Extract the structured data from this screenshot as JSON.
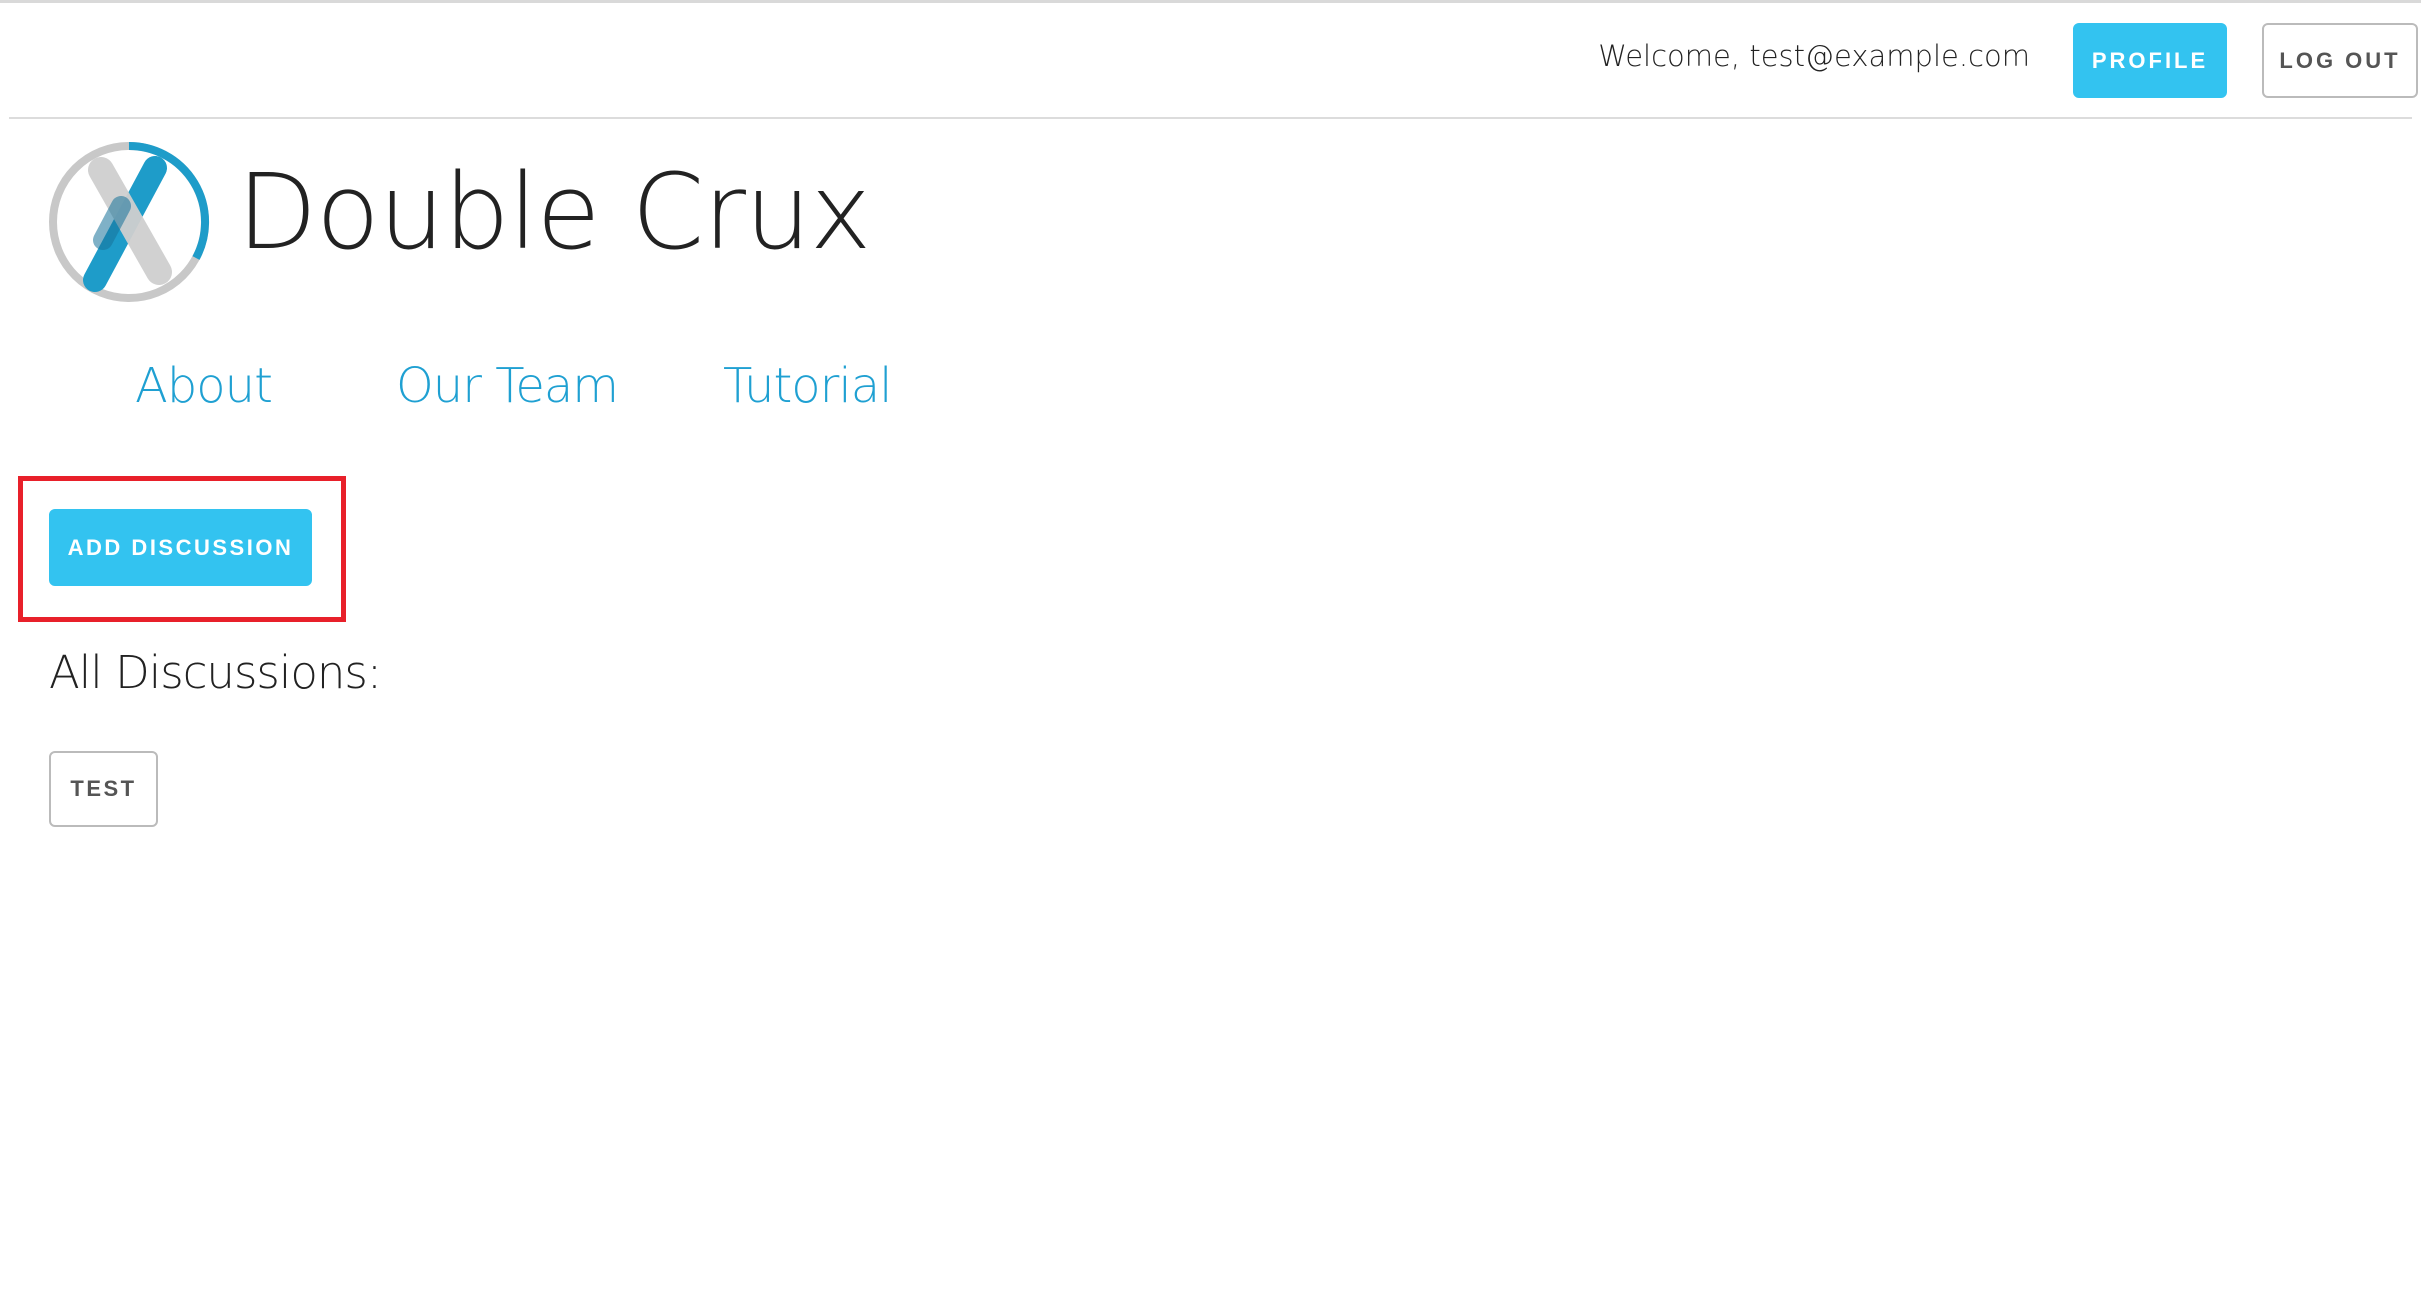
{
  "header": {
    "welcome_text": "Welcome, test@example.com",
    "profile_label": "PROFILE",
    "logout_label": "LOG OUT"
  },
  "brand": {
    "name": "Double Crux",
    "logo_icon": "double-crux-x-logo",
    "colors": {
      "accent": "#33c3f0",
      "link": "#1fa0d2",
      "logo_blue": "#1e9cc9",
      "logo_gray": "#c8c8c8"
    }
  },
  "nav": {
    "items": [
      {
        "label": "About"
      },
      {
        "label": "Our Team"
      },
      {
        "label": "Tutorial"
      }
    ]
  },
  "main": {
    "add_discussion_label": "ADD DISCUSSION",
    "highlight_color": "#e8202a",
    "section_title": "All Discussions:",
    "discussions": [
      {
        "label": "TEST"
      }
    ]
  }
}
